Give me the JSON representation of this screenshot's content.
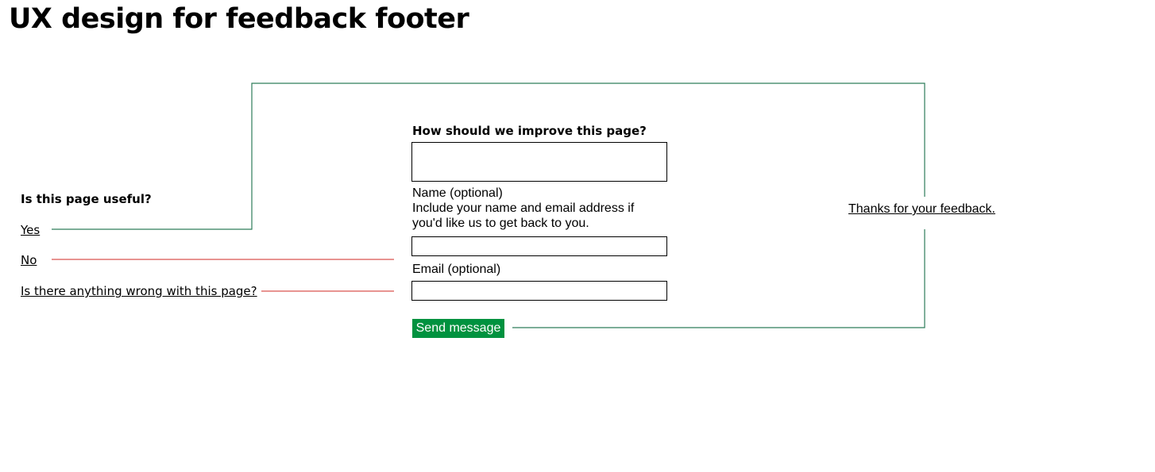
{
  "page": {
    "title": "UX design for feedback footer"
  },
  "feedback_prompt": {
    "heading": "Is this page useful?",
    "yes_label": "Yes",
    "no_label": "No",
    "wrong_label": "Is there anything wrong with this page?"
  },
  "form": {
    "heading": "How should we improve this page?",
    "name_label": "Name (optional)",
    "name_hint": "Include your name and email address if you'd like us to get back to you.",
    "email_label": "Email (optional)",
    "improve_value": "",
    "name_value": "",
    "email_value": "",
    "send_label": "Send message"
  },
  "confirmation": {
    "text": "Thanks for your feedback."
  },
  "colors": {
    "positive_connector": "#2e7d5b",
    "negative_connector": "#d9534f",
    "send_button": "#00923f"
  }
}
